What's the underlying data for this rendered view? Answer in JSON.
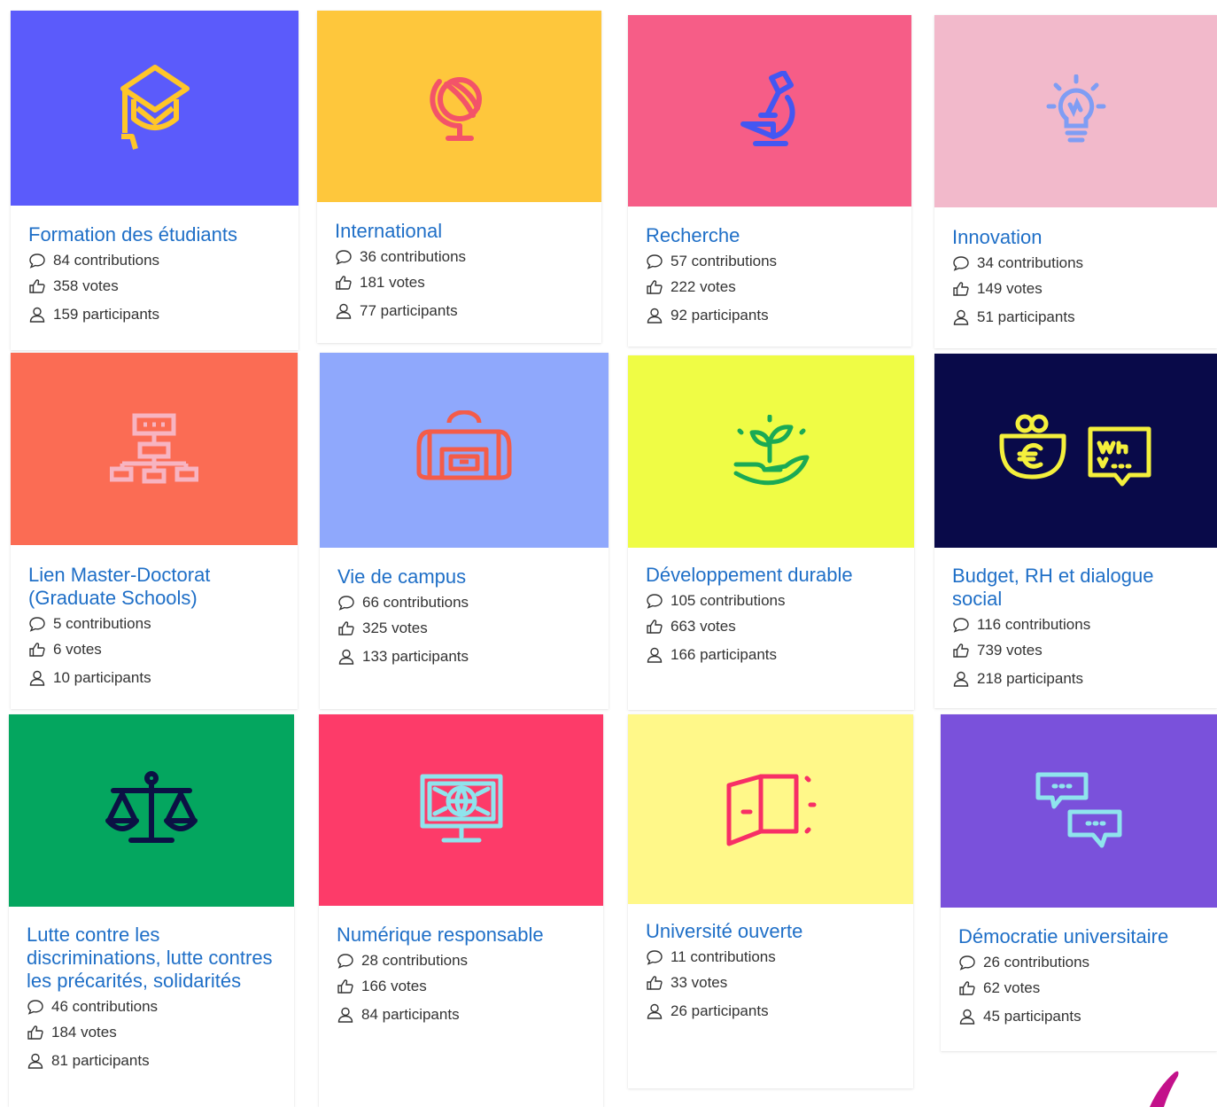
{
  "cards": [
    {
      "title": "Formation des étudiants",
      "contributions": "84 contributions",
      "votes": "358 votes",
      "participants": "159 participants",
      "color": "#5b5bfb",
      "icon": "graduation-cap-icon",
      "icon_color": "#ffc629"
    },
    {
      "title": "International",
      "contributions": "36 contributions",
      "votes": "181 votes",
      "participants": "77 participants",
      "color": "#fec73c",
      "icon": "globe-icon",
      "icon_color": "#f35369"
    },
    {
      "title": "Recherche",
      "contributions": "57 contributions",
      "votes": "222 votes",
      "participants": "92 participants",
      "color": "#f65d87",
      "icon": "microscope-icon",
      "icon_color": "#4357f2"
    },
    {
      "title": "Innovation",
      "contributions": "34 contributions",
      "votes": "149 votes",
      "participants": "51 participants",
      "color": "#f2b9cb",
      "icon": "lightbulb-icon",
      "icon_color": "#7f9df4"
    },
    {
      "title": "Lien Master-Doctorat (Graduate Schools)",
      "contributions": "5 contributions",
      "votes": "6 votes",
      "participants": "10 participants",
      "color": "#fb6c54",
      "icon": "org-chart-icon",
      "icon_color": "#f7b4c1"
    },
    {
      "title": "Vie de campus",
      "contributions": "66 contributions",
      "votes": "325 votes",
      "participants": "133 participants",
      "color": "#8fa8fc",
      "icon": "backpack-icon",
      "icon_color": "#f45c49"
    },
    {
      "title": "Développement durable",
      "contributions": "105 contributions",
      "votes": "663 votes",
      "participants": "166 participants",
      "color": "#effc45",
      "icon": "plant-in-hand-icon",
      "icon_color": "#1aaa55"
    },
    {
      "title": "Budget, RH et dialogue social",
      "contributions": "116 contributions",
      "votes": "739 votes",
      "participants": "218 participants",
      "color": "#090a49",
      "icon": "budget-euro-dialogue-icon",
      "icon_color": "#f4f03c"
    },
    {
      "title": "Lutte contre les discriminations, lutte contres les précarités, solidarités",
      "contributions": "46 contributions",
      "votes": "184 votes",
      "participants": "81 participants",
      "color": "#04a65f",
      "icon": "scales-icon",
      "icon_color": "#0b1144"
    },
    {
      "title": "Numérique responsable",
      "contributions": "28 contributions",
      "votes": "166 votes",
      "participants": "84 participants",
      "color": "#fd3b69",
      "icon": "monitor-globe-icon",
      "icon_color": "#8fe4ed"
    },
    {
      "title": "Université ouverte",
      "contributions": "11 contributions",
      "votes": "33 votes",
      "participants": "26 participants",
      "color": "#fff889",
      "icon": "open-door-icon",
      "icon_color": "#f72f66"
    },
    {
      "title": "Démocratie universitaire",
      "contributions": "26 contributions",
      "votes": "62 votes",
      "participants": "45 participants",
      "color": "#7a51db",
      "icon": "speech-bubbles-icon",
      "icon_color": "#8fe4ed"
    }
  ],
  "accent_color": "#c3118a"
}
